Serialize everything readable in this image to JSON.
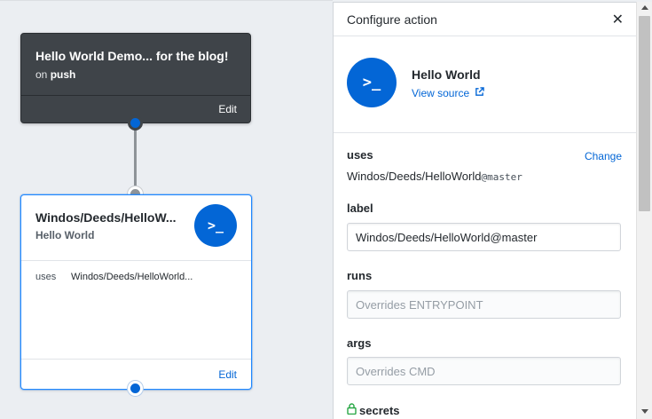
{
  "workflow": {
    "title": "Hello World Demo... for the blog!",
    "on_prefix": "on",
    "trigger": "push",
    "edit_label": "Edit"
  },
  "action_card": {
    "title": "Windos/Deeds/HelloW...",
    "subtitle": "Hello World",
    "icon_text": ">_",
    "uses_key": "uses",
    "uses_value": "Windos/Deeds/HelloWorld...",
    "edit_label": "Edit"
  },
  "panel": {
    "title": "Configure action",
    "close_glyph": "✕",
    "action_name": "Hello World",
    "icon_text": ">_",
    "view_source_label": "View source",
    "uses_label": "uses",
    "change_label": "Change",
    "uses_repo": "Windos/Deeds/HelloWorld",
    "uses_ref": "@master",
    "label_label": "label",
    "label_value": "Windos/Deeds/HelloWorld@master",
    "runs_label": "runs",
    "runs_placeholder": "Overrides ENTRYPOINT",
    "args_label": "args",
    "args_placeholder": "Overrides CMD",
    "secrets_label": "secrets"
  },
  "colors": {
    "accent": "#0366d6",
    "dark_card": "#3f4449",
    "lock": "#28a745"
  }
}
